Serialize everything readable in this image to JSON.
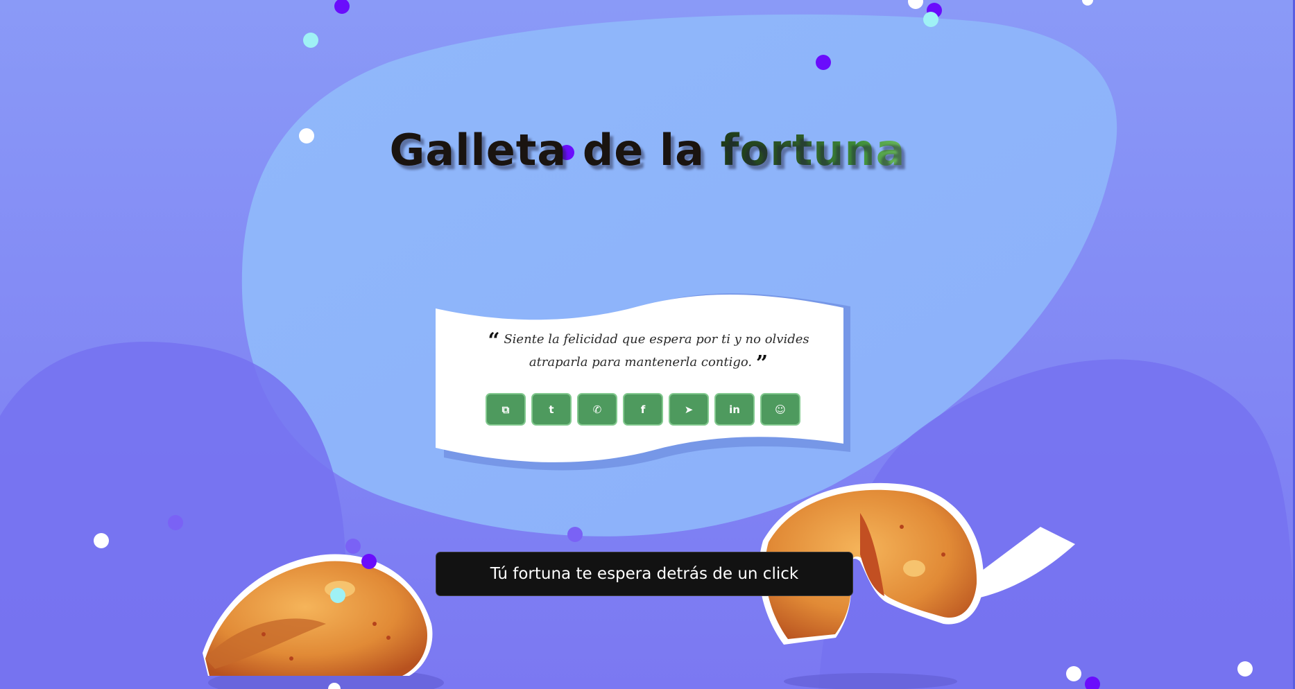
{
  "page": {
    "title_main": "Galleta de la ",
    "title_accent": "fortuna"
  },
  "quote": {
    "open_mark": "“",
    "text": "Siente la felicidad que espera por ti y no olvides atraparla para mantenerla contigo.",
    "close_mark": "”"
  },
  "share_buttons": [
    {
      "name": "copy-button",
      "icon": "copy-icon",
      "glyph": "⧉"
    },
    {
      "name": "twitter-button",
      "icon": "twitter-icon",
      "glyph": "t"
    },
    {
      "name": "whatsapp-button",
      "icon": "whatsapp-icon",
      "glyph": "✆"
    },
    {
      "name": "facebook-button",
      "icon": "facebook-icon",
      "glyph": "f"
    },
    {
      "name": "telegram-button",
      "icon": "telegram-icon",
      "glyph": "➤"
    },
    {
      "name": "linkedin-button",
      "icon": "linkedin-icon",
      "glyph": "in"
    },
    {
      "name": "reddit-button",
      "icon": "reddit-icon",
      "glyph": "☺"
    }
  ],
  "cta": {
    "label": "Tú fortuna te espera detrás de un click"
  },
  "colors": {
    "background": "#8a8df5",
    "blob": "#90b8fa",
    "share_button": "#4e9a5e",
    "cta_background": "#121212",
    "confetti": [
      "#ffffff",
      "#6a0dfc",
      "#9ff1f5"
    ]
  }
}
